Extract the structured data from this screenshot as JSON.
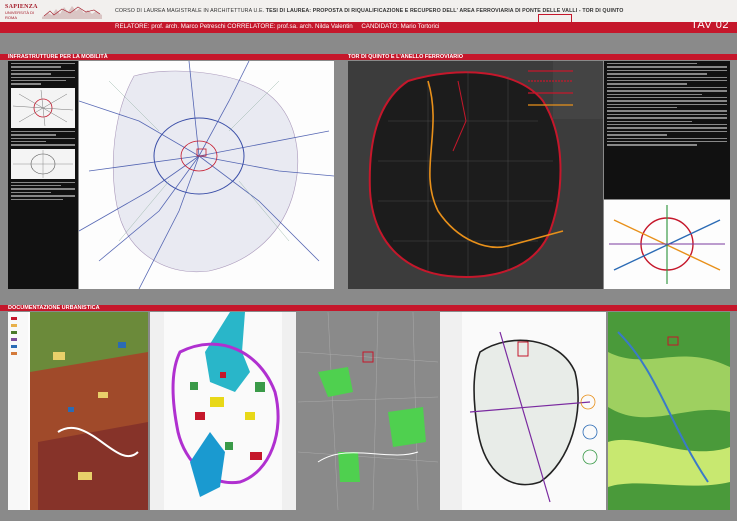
{
  "header": {
    "logo_text": "SAPIENZA",
    "logo_sub": "UNIVERSITÀ DI ROMA",
    "course": "CORSO DI LAUREA MAGISTRALE IN ARCHITETTURA U.E.",
    "thesis_label": "TESI DI LAUREA:",
    "thesis_title": "PROPOSTA DI RIQUALIFICAZIONE E RECUPERO DELL' AREA FERROVIARIA DI PONTE DELLE VALLI - TOR DI QUINTO",
    "relatore": "RELATORE: prof. arch. Marco Petreschi CORRELATORE: prof.sa. arch. Nilda Valentin",
    "candidato": "CANDIDATO: Mario Tortorici",
    "tav": "TAV 02"
  },
  "sections": {
    "infra": "INFRASTRUTTURE PER LA MOBILITÀ",
    "anello": "TOR DI QUINTO E L'ANELLO FERROVIARIO",
    "doc": "DOCUMENTAZIONE URBANISTICA"
  },
  "colors": {
    "accent": "#c5172b",
    "dark": "#111111",
    "orange": "#e8901a"
  }
}
